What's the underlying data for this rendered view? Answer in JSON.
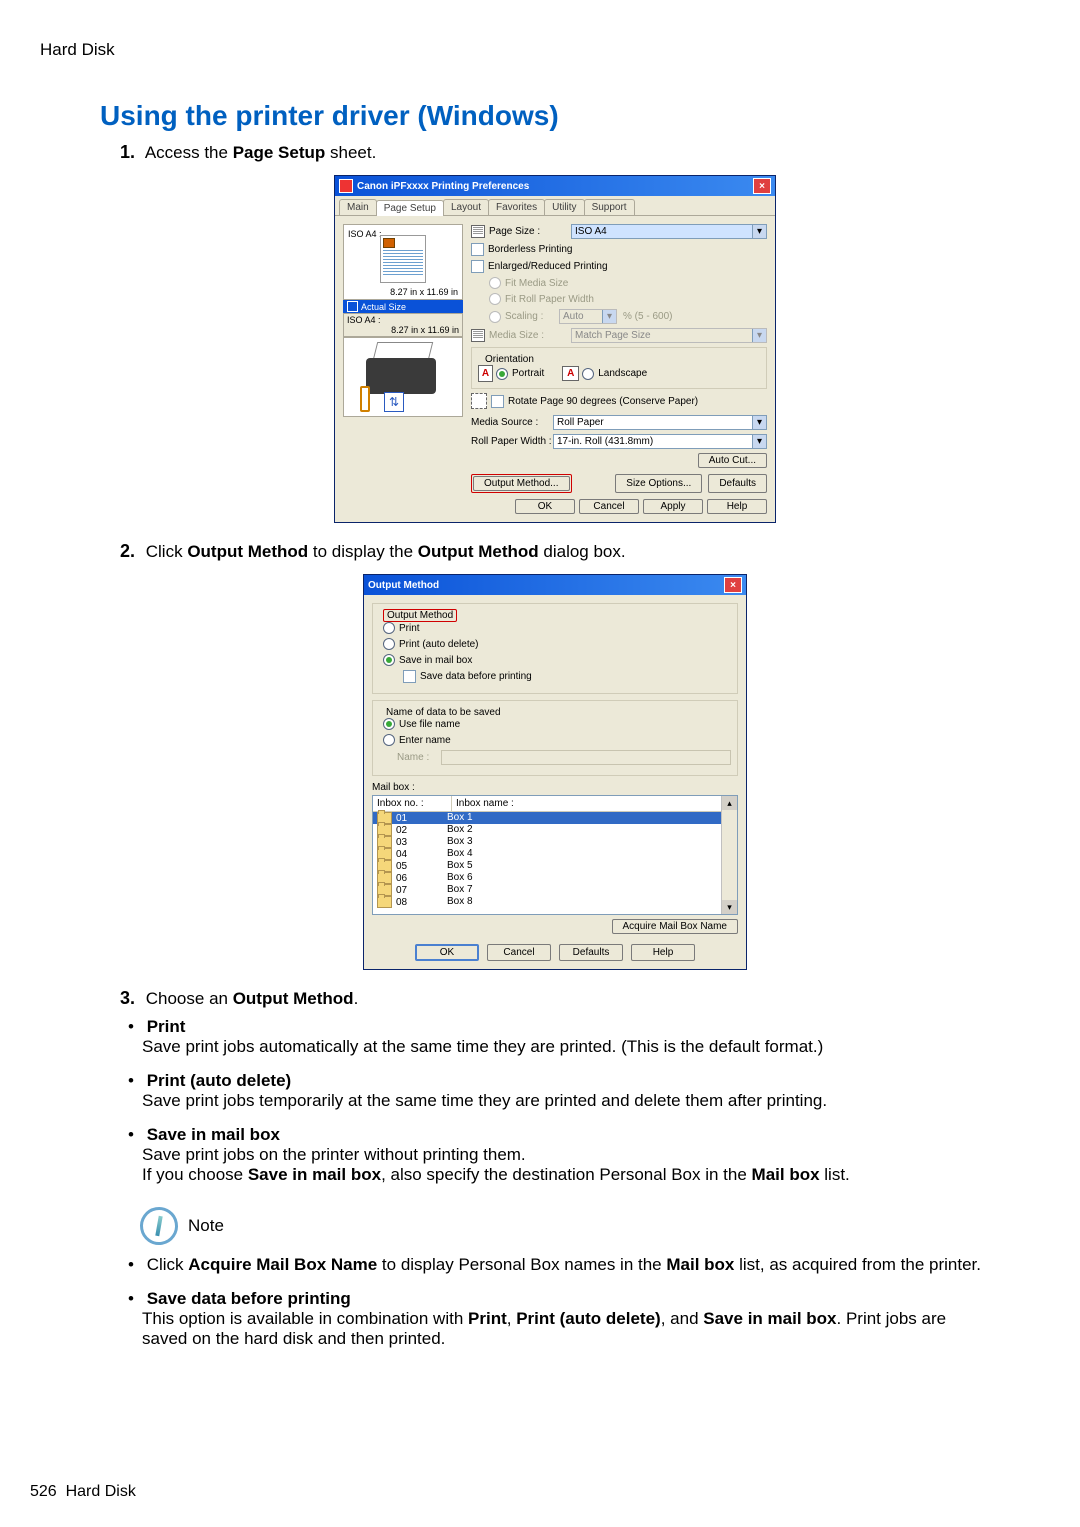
{
  "doc": {
    "section": "Hard Disk",
    "title": "Using the printer driver (Windows)",
    "step1_prefix": "Access the ",
    "step1_hl": "Page Setup",
    "step1_suffix": " sheet.",
    "step2_prefix": "Click ",
    "step2_hl1": "Output Method",
    "step2_mid": " to display the ",
    "step2_hl2": "Output Method",
    "step2_suffix": " dialog box.",
    "step3_prefix": "Choose an ",
    "step3_hl": "Output Method",
    "opt_print_title": "Print",
    "opt_print_text": "Save print jobs automatically at the same time they are printed. (This is the default format.)",
    "opt_pad_title": "Print (auto delete)",
    "opt_pad_text": "Save print jobs temporarily at the same time they are printed and delete them after printing.",
    "opt_smb_title": "Save in mail box",
    "opt_smb_text1": "Save print jobs on the printer without printing them.",
    "opt_smb_text2_a": "If you choose ",
    "opt_smb_text2_b": "Save in mail box",
    "opt_smb_text2_c": ", also specify the destination Personal Box in the ",
    "opt_smb_text2_d": "Mail box",
    "opt_smb_text2_e": " list.",
    "note_label": "Note",
    "note1_a": "Click ",
    "note1_b": "Acquire Mail Box Name",
    "note1_c": " to display Personal Box names in the ",
    "note1_d": "Mail box",
    "note1_e": " list, as acquired from the printer.",
    "note2_title": "Save data before printing",
    "note2_text_a": "This option is available in combination with ",
    "note2_text_b": "Print",
    "note2_text_c": ", ",
    "note2_text_d": "Print (auto delete)",
    "note2_text_e": ", and ",
    "note2_text_f": "Save in mail box",
    "note2_text_g": ". Print jobs are saved on the hard disk and then printed.",
    "footer_page": "526",
    "footer_section": "Hard Disk"
  },
  "page_setup_dlg": {
    "title": "Canon iPFxxxx Printing Preferences",
    "tabs": [
      "Main",
      "Page Setup",
      "Layout",
      "Favorites",
      "Utility",
      "Support"
    ],
    "active_tab": "Page Setup",
    "iso_label": "ISO A4 :",
    "iso_dim": "8.27 in x 11.69 in",
    "actual_size_label": "Actual Size",
    "iso2_label": "ISO A4 :",
    "iso2_dim": "8.27 in x 11.69 in",
    "page_size_lbl": "Page Size :",
    "page_size_val": "ISO A4",
    "borderless_lbl": "Borderless Printing",
    "enlarged_lbl": "Enlarged/Reduced Printing",
    "fit_media": "Fit Media Size",
    "fit_roll": "Fit Roll Paper Width",
    "scaling": "Scaling :",
    "scaling_val": "Auto",
    "scaling_range": "% (5 - 600)",
    "media_size_lbl": "Media Size :",
    "media_size_val": "Match Page Size",
    "orientation_lbl": "Orientation",
    "portrait": "Portrait",
    "landscape": "Landscape",
    "rotate90": "Rotate Page 90 degrees (Conserve Paper)",
    "media_source_lbl": "Media Source :",
    "media_source_val": "Roll Paper",
    "roll_width_lbl": "Roll Paper Width :",
    "roll_width_val": "17-in. Roll (431.8mm)",
    "auto_cut_btn": "Auto Cut...",
    "output_method_btn": "Output Method...",
    "size_options_btn": "Size Options...",
    "defaults_btn": "Defaults",
    "ok": "OK",
    "cancel": "Cancel",
    "apply": "Apply",
    "help": "Help"
  },
  "output_method_dlg": {
    "title": "Output Method",
    "group1": "Output Method",
    "opt_print": "Print",
    "opt_pad": "Print (auto delete)",
    "opt_smb": "Save in mail box",
    "save_before": "Save data before printing",
    "group2": "Name of data to be saved",
    "use_file": "Use file name",
    "enter_name": "Enter name",
    "name_lbl": "Name :",
    "mailbox_lbl": "Mail box :",
    "col_no": "Inbox no. :",
    "col_name": "Inbox name :",
    "rows": [
      {
        "no": "01",
        "name": "Box 1",
        "sel": true
      },
      {
        "no": "02",
        "name": "Box 2"
      },
      {
        "no": "03",
        "name": "Box 3"
      },
      {
        "no": "04",
        "name": "Box 4"
      },
      {
        "no": "05",
        "name": "Box 5"
      },
      {
        "no": "06",
        "name": "Box 6"
      },
      {
        "no": "07",
        "name": "Box 7"
      },
      {
        "no": "08",
        "name": "Box 8"
      }
    ],
    "acquire_btn": "Acquire Mail Box Name",
    "ok": "OK",
    "cancel": "Cancel",
    "defaults": "Defaults",
    "help": "Help"
  }
}
